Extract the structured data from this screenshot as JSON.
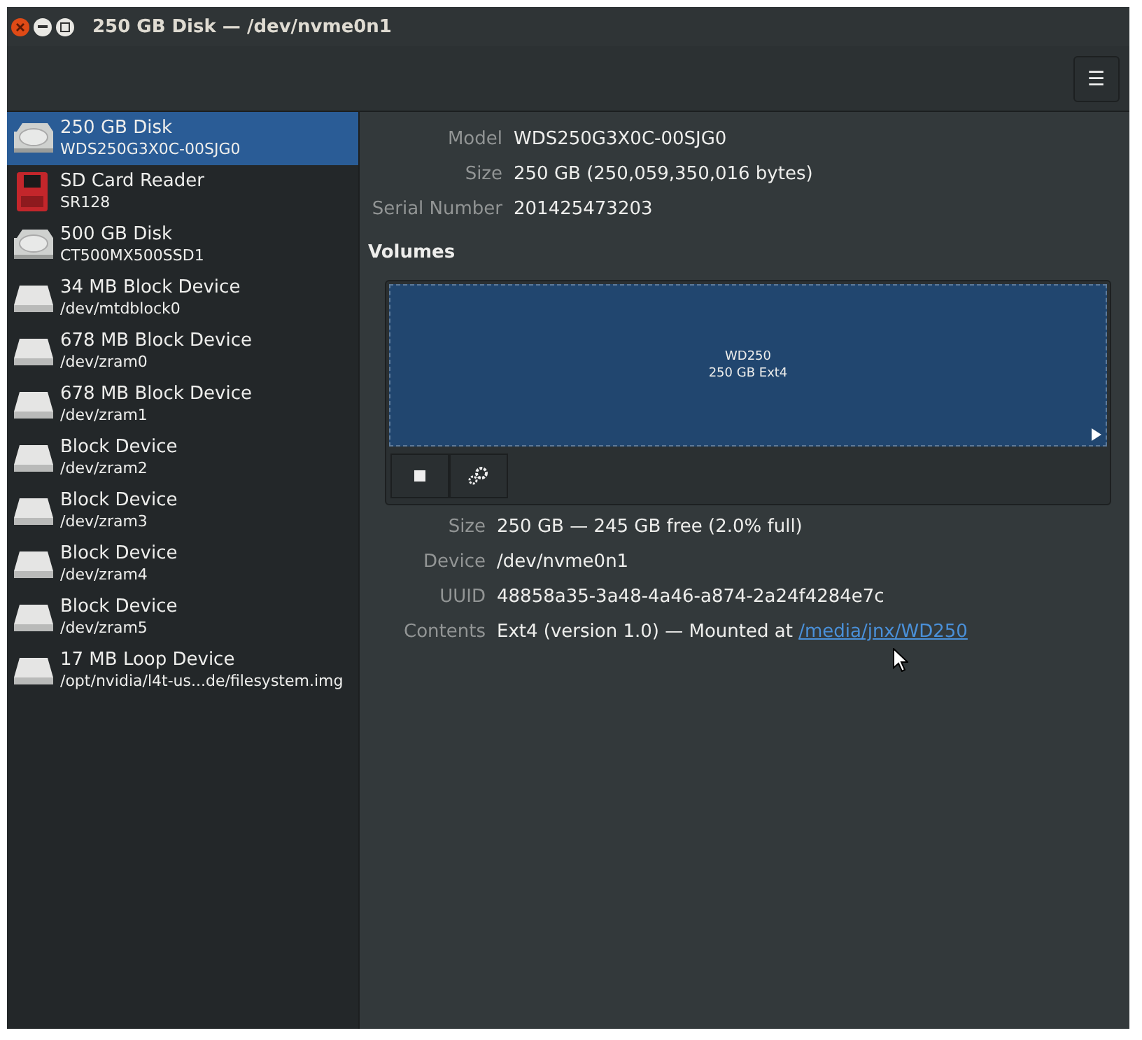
{
  "window": {
    "title": "250 GB Disk — /dev/nvme0n1"
  },
  "menu_button": {
    "label": "☰"
  },
  "devices": [
    {
      "kind": "disk",
      "name": "250 GB Disk",
      "detail": "WDS250G3X0C-00SJG0",
      "selected": true
    },
    {
      "kind": "sdcard",
      "name": "SD Card Reader",
      "detail": "SR128",
      "selected": false
    },
    {
      "kind": "disk",
      "name": "500 GB Disk",
      "detail": "CT500MX500SSD1",
      "selected": false
    },
    {
      "kind": "block",
      "name": "34 MB Block Device",
      "detail": "/dev/mtdblock0",
      "selected": false
    },
    {
      "kind": "block",
      "name": "678 MB Block Device",
      "detail": "/dev/zram0",
      "selected": false
    },
    {
      "kind": "block",
      "name": "678 MB Block Device",
      "detail": "/dev/zram1",
      "selected": false
    },
    {
      "kind": "block",
      "name": "Block Device",
      "detail": "/dev/zram2",
      "selected": false
    },
    {
      "kind": "block",
      "name": "Block Device",
      "detail": "/dev/zram3",
      "selected": false
    },
    {
      "kind": "block",
      "name": "Block Device",
      "detail": "/dev/zram4",
      "selected": false
    },
    {
      "kind": "block",
      "name": "Block Device",
      "detail": "/dev/zram5",
      "selected": false
    },
    {
      "kind": "block",
      "name": "17 MB Loop Device",
      "detail": "/opt/nvidia/l4t-us...de/filesystem.img",
      "selected": false
    }
  ],
  "disk_properties": [
    {
      "label": "Model",
      "value": "WDS250G3X0C-00SJG0"
    },
    {
      "label": "Size",
      "value": "250 GB (250,059,350,016 bytes)"
    },
    {
      "label": "Serial Number",
      "value": "201425473203"
    }
  ],
  "volumes": {
    "heading": "Volumes",
    "partition": {
      "name": "WD250",
      "description": "250 GB Ext4",
      "selected": true
    }
  },
  "volume_properties": [
    {
      "label": "Size",
      "value": "250 GB — 245 GB free (2.0% full)"
    },
    {
      "label": "Device",
      "value": "/dev/nvme0n1"
    },
    {
      "label": "UUID",
      "value": "48858a35-3a48-4a46-a874-2a24f4284e7c"
    },
    {
      "label": "Contents",
      "value": "Ext4 (version 1.0) — Mounted at",
      "link": "/media/jnx/WD250"
    }
  ]
}
